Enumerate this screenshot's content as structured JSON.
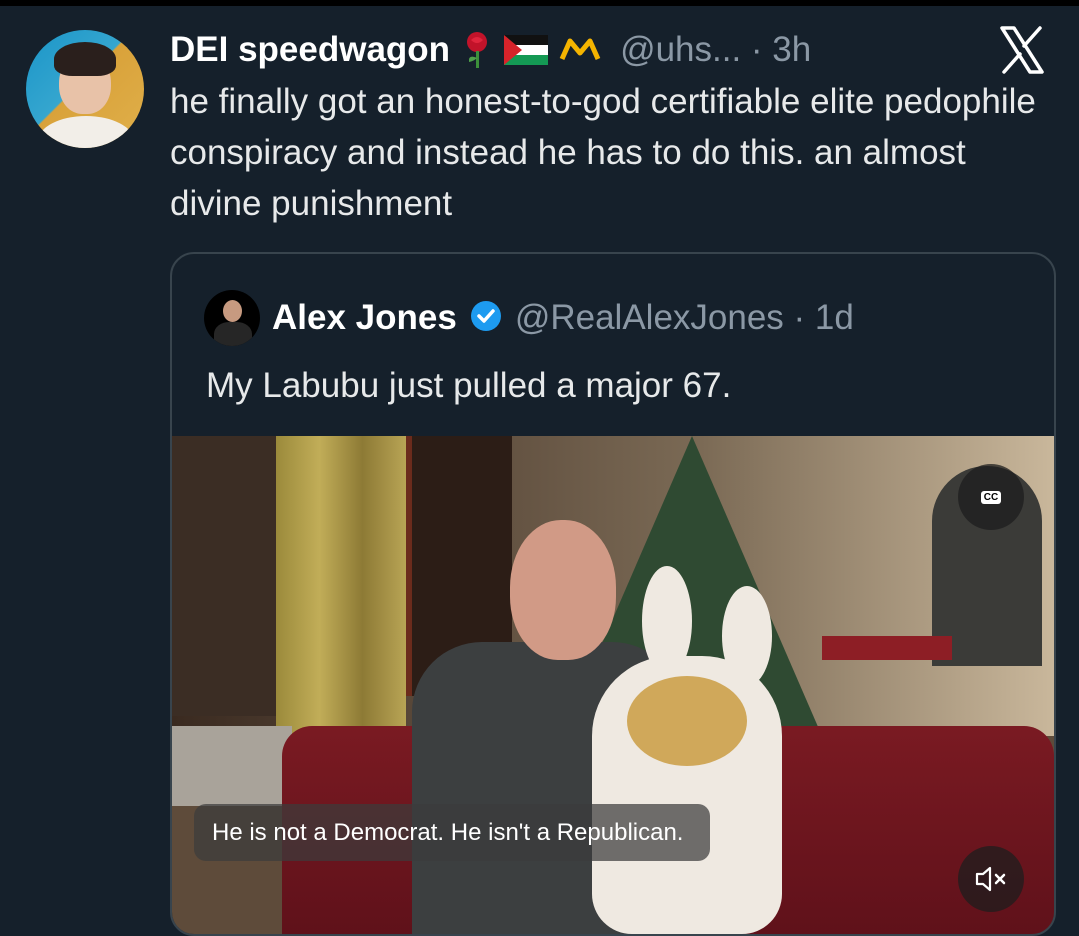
{
  "tweet": {
    "author_name": "DEI speedwagon",
    "emoji": [
      "rose",
      "palestine-flag",
      "yellow-crown-mark"
    ],
    "handle_time": "@uhs... · 3h",
    "text": "he finally got an honest-to-god certifiable elite pedophile conspiracy and instead he has to do this. an almost divine punishment"
  },
  "quote": {
    "author_name": "Alex Jones",
    "verified": true,
    "handle_time": "@RealAlexJones · 1d",
    "text": "My Labubu just pulled a major 67.",
    "video": {
      "cc_label": "CC",
      "caption": "He is not a Democrat. He isn't a Republican."
    }
  },
  "colors": {
    "background": "#15202b",
    "text": "#e7e9ea",
    "muted": "#8b98a5",
    "verified_blue": "#1d9bf0",
    "border": "#38444d"
  }
}
